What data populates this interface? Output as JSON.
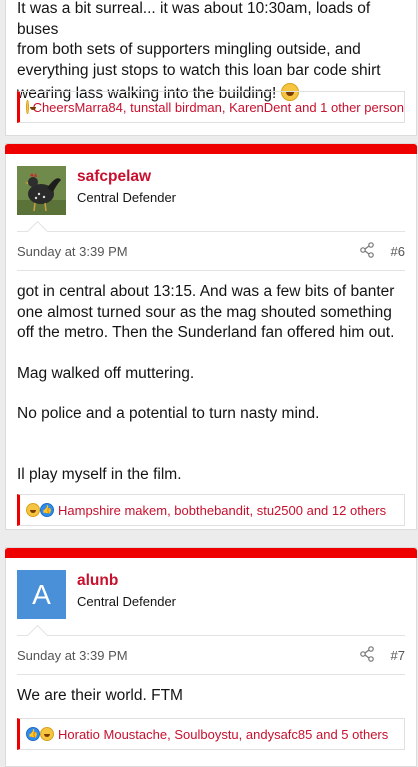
{
  "posts": [
    {
      "body_lines": [
        "It was a bit surreal... it was about 10:30am, loads of buses",
        "from both sets of supporters mingling outside, and",
        "everything just stops to watch this loan bar code shirt",
        "wearing lass walking into the building!"
      ],
      "reaction_icons": [
        "laugh-emoji"
      ],
      "reactions": "CheersMarra84, tunstall birdman, KarenDent and 1 other person"
    },
    {
      "username": "safcpelaw",
      "user_title": "Central Defender",
      "avatar_icon": "rooster-avatar",
      "date": "Sunday at 3:39 PM",
      "post_number": "#6",
      "body": [
        "got in central about 13:15. And was a few bits of banter one almost turned sour as the mag shouted something off the metro. Then the Sunderland fan offered him out.",
        "Mag walked off muttering.",
        "No police and a potential to turn nasty mind.",
        "Il play myself in the film."
      ],
      "reaction_icons": [
        "laugh-emoji",
        "like-emoji"
      ],
      "reactions": "Hampshire makem, bobthebandit, stu2500 and 12 others"
    },
    {
      "username": "alunb",
      "user_title": "Central Defender",
      "avatar_letter": "A",
      "date": "Sunday at 3:39 PM",
      "post_number": "#7",
      "body": [
        "We are their world. FTM"
      ],
      "reaction_icons": [
        "like-emoji",
        "laugh-emoji"
      ],
      "reactions": "Horatio Moustache, Soulboystu, andysafc85 and 5 others"
    }
  ],
  "colors": {
    "accent": "#ee0000",
    "link": "#c8102e",
    "avatar_a": "#4a90d9"
  }
}
